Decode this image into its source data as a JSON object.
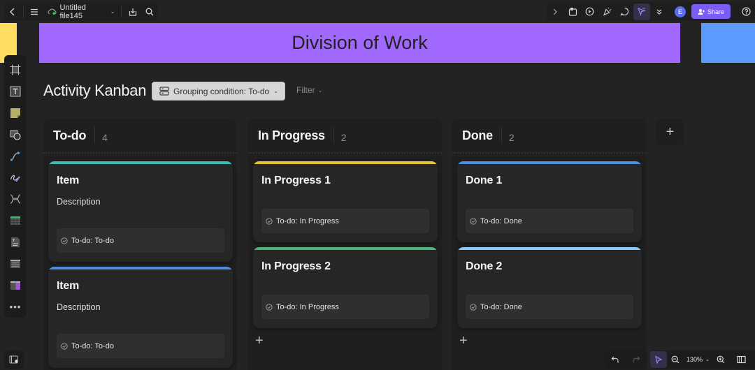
{
  "topbar": {
    "file_name": "Untitled file145",
    "icons": [
      "back-icon",
      "menu-icon",
      "cloud-sync-icon",
      "download-icon",
      "search-icon"
    ],
    "right_icons": [
      "expand-icon",
      "template-icon",
      "present-icon",
      "celebrate-icon",
      "comment-icon",
      "cursor-icon",
      "more-icon"
    ],
    "avatar_initial": "E",
    "share_label": "Share",
    "share_color": "#7b5cf5"
  },
  "banner": {
    "title": "Division of Work",
    "color": "#a168fd"
  },
  "tool_rail": {
    "tools": [
      "frame-tool",
      "text-tool",
      "sticky-note-tool",
      "shape-tool",
      "connector-tool",
      "pen-tool",
      "mindmap-tool",
      "table-tool",
      "doc-tool",
      "list-tool",
      "kanban-tool"
    ],
    "more_label": "•••"
  },
  "kanban": {
    "title": "Activity Kanban",
    "grouping_label": "Grouping condition: To-do",
    "filter_label": "Filter",
    "columns": [
      {
        "title": "To-do",
        "count": "4",
        "cards": [
          {
            "title": "Item",
            "description": "Description",
            "tag": "To-do: To-do",
            "accent": "#3dbdb2"
          },
          {
            "title": "Item",
            "description": "Description",
            "tag": "To-do: To-do",
            "accent": "#4a8fe0"
          }
        ]
      },
      {
        "title": "In Progress",
        "count": "2",
        "cards": [
          {
            "title": "In Progress 1",
            "tag": "To-do: In Progress",
            "accent": "#e8c233"
          },
          {
            "title": "In Progress 2",
            "tag": "To-do: In Progress",
            "accent": "#4fb378"
          }
        ],
        "add_label": "+"
      },
      {
        "title": "Done",
        "count": "2",
        "cards": [
          {
            "title": "Done 1",
            "tag": "To-do: Done",
            "accent": "#4a8fe0"
          },
          {
            "title": "Done 2",
            "tag": "To-do: Done",
            "accent": "#8cc8f5"
          }
        ],
        "add_label": "+"
      }
    ],
    "add_column_label": "+"
  },
  "bottom_toolbar": {
    "zoom_level": "130%"
  }
}
